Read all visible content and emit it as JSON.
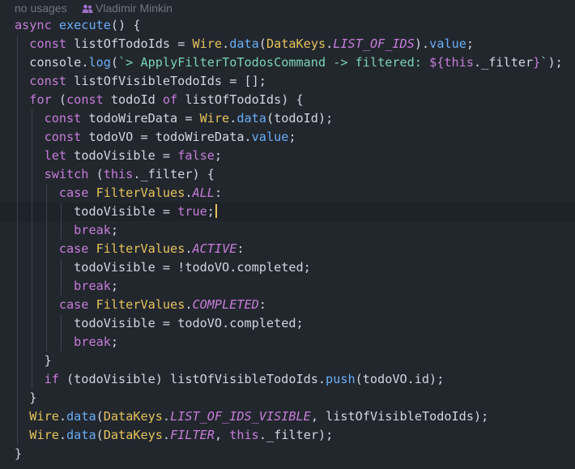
{
  "hint": {
    "usages": "no usages",
    "author": "Vladimir Minkin"
  },
  "code": {
    "l1": {
      "kw1": "async",
      "fn": "execute",
      "rest": "() {"
    },
    "l2": {
      "kw": "const",
      "var": "listOfTodoIds",
      "eq": " = ",
      "cls": "Wire",
      "dot": ".",
      "call": "data",
      "p1": "(",
      "cls2": "DataKeys",
      "dot2": ".",
      "ct": "LIST_OF_IDS",
      "p2": ")",
      "dot3": ".",
      "field": "value",
      "end": ";"
    },
    "l3": {
      "obj": "console",
      "dot": ".",
      "call": "log",
      "p1": "(",
      "str": "`> ApplyFilterToTodosCommand -> filtered: ",
      "tplo": "${",
      "kw": "this",
      "rest": "._filter",
      "tplc": "}",
      "strend": "`",
      "end": ");"
    },
    "l4": {
      "kw": "const",
      "var": "listOfVisibleTodoIds",
      "eq": " = ",
      "rest": "[];"
    },
    "l5": {
      "kw": "for",
      "p1": " (",
      "kw2": "const",
      "var": " todoId ",
      "kw3": "of",
      "rest": " listOfTodoIds) {"
    },
    "l6": {
      "kw": "const",
      "var": "todoWireData",
      "eq": " = ",
      "cls": "Wire",
      "dot": ".",
      "call": "data",
      "rest": "(todoId);"
    },
    "l7": {
      "kw": "const",
      "var": "todoVO",
      "eq": " = ",
      "obj": "todoWireData",
      "dot": ".",
      "field": "value",
      "end": ";"
    },
    "l8": {
      "kw": "let",
      "var": "todoVisible",
      "eq": " = ",
      "lit": "false",
      "end": ";"
    },
    "l9": {
      "kw": "switch",
      "p1": " (",
      "kw2": "this",
      "rest": "._filter) {"
    },
    "l10": {
      "kw": "case",
      "sp": " ",
      "enum": "FilterValues",
      "dot": ".",
      "ct": "ALL",
      "end": ":"
    },
    "l11": {
      "var": "todoVisible",
      "eq": " = ",
      "lit": "true",
      "end": ";"
    },
    "l12": {
      "kw": "break",
      "end": ";"
    },
    "l13": {
      "kw": "case",
      "sp": " ",
      "enum": "FilterValues",
      "dot": ".",
      "ct": "ACTIVE",
      "end": ":"
    },
    "l14": {
      "var": "todoVisible",
      "eq": " = !",
      "obj": "todoVO",
      "dot": ".",
      "field": "completed",
      "end": ";"
    },
    "l15": {
      "kw": "break",
      "end": ";"
    },
    "l16": {
      "kw": "case",
      "sp": " ",
      "enum": "FilterValues",
      "dot": ".",
      "ct": "COMPLETED",
      "end": ":"
    },
    "l17": {
      "var": "todoVisible",
      "eq": " = ",
      "obj": "todoVO",
      "dot": ".",
      "field": "completed",
      "end": ";"
    },
    "l18": {
      "kw": "break",
      "end": ";"
    },
    "l19": {
      "rest": "}"
    },
    "l20": {
      "kw": "if",
      "rest": " (todoVisible) listOfVisibleTodoIds.",
      "call": "push",
      "end": "(todoVO.id);"
    },
    "l21": {
      "rest": "}"
    },
    "l22": {
      "cls": "Wire",
      "dot": ".",
      "call": "data",
      "p1": "(",
      "cls2": "DataKeys",
      "dot2": ".",
      "ct": "LIST_OF_IDS_VISIBLE",
      "rest": ", listOfVisibleTodoIds);"
    },
    "l23": {
      "cls": "Wire",
      "dot": ".",
      "call": "data",
      "p1": "(",
      "cls2": "DataKeys",
      "dot2": ".",
      "ct": "FILTER",
      "rest": ", ",
      "kw": "this",
      "end": "._filter);"
    },
    "l24": {
      "rest": "}"
    }
  },
  "colors": {
    "background": "#22272e",
    "current_line": "#1e2329",
    "keyword": "#c77dd9",
    "function": "#6aaef5",
    "class": "#e6c35a",
    "string": "#7ad3b5",
    "text": "#d2d7df",
    "hint": "#6f7782",
    "caret": "#e6c35a"
  },
  "icons": {
    "author": "people-icon"
  }
}
